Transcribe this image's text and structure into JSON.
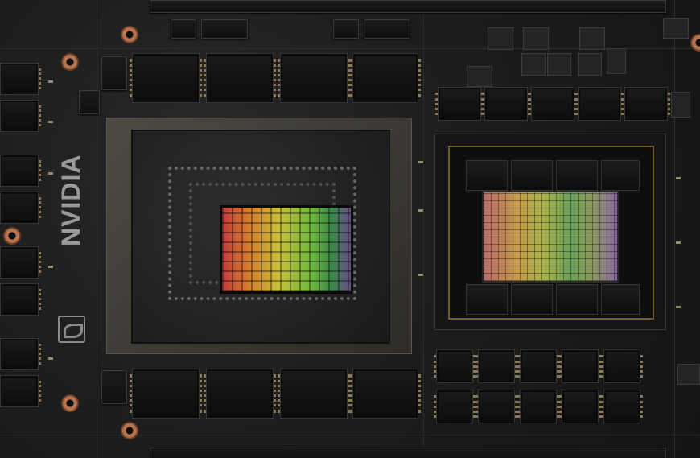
{
  "image": {
    "brand_text": "NVIDIA",
    "colors": {
      "board": "#1e1e1e",
      "cpu_lid": "#4d4a44",
      "mounting_pad": "#b5734f",
      "die_accent": "#6bb83c"
    },
    "icons": [
      "nvidia-eye-logo-icon",
      "mounting-hole-icon"
    ]
  }
}
